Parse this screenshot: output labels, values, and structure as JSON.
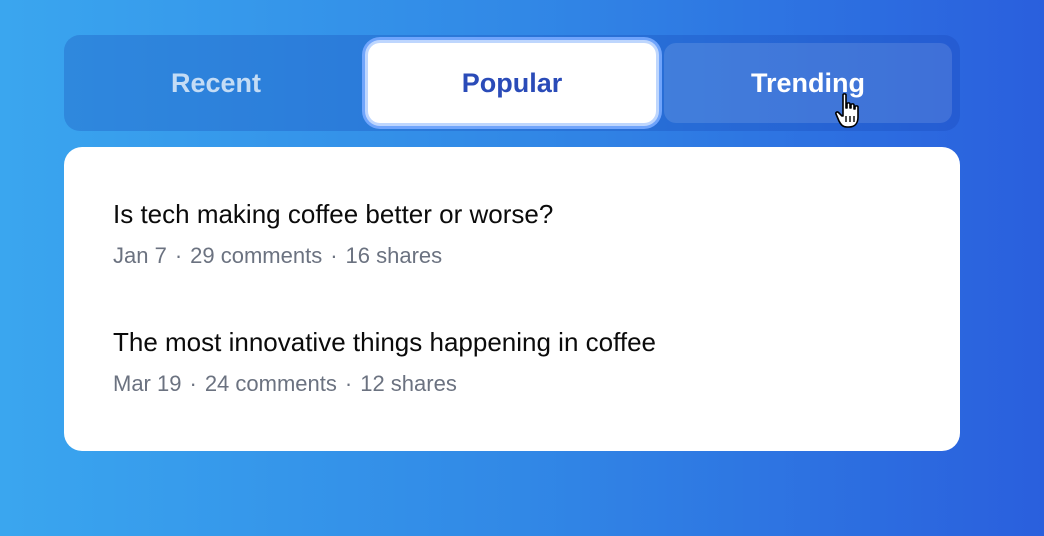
{
  "tabs": {
    "recent": {
      "label": "Recent",
      "active": false
    },
    "popular": {
      "label": "Popular",
      "active": true
    },
    "trending": {
      "label": "Trending",
      "active": false
    }
  },
  "posts": [
    {
      "title": "Is tech making coffee better or worse?",
      "date": "Jan 7",
      "comments": "29 comments",
      "shares": "16 shares"
    },
    {
      "title": "The most innovative things happening in coffee",
      "date": "Mar 19",
      "comments": "24 comments",
      "shares": "12 shares"
    }
  ],
  "separator": "·",
  "colors": {
    "active_tab_text": "#2a4bb8",
    "meta_text": "#6b7280",
    "title_text": "#0b0b0b",
    "card_background": "#ffffff"
  },
  "icons": {
    "cursor": "hand-pointer-icon"
  }
}
